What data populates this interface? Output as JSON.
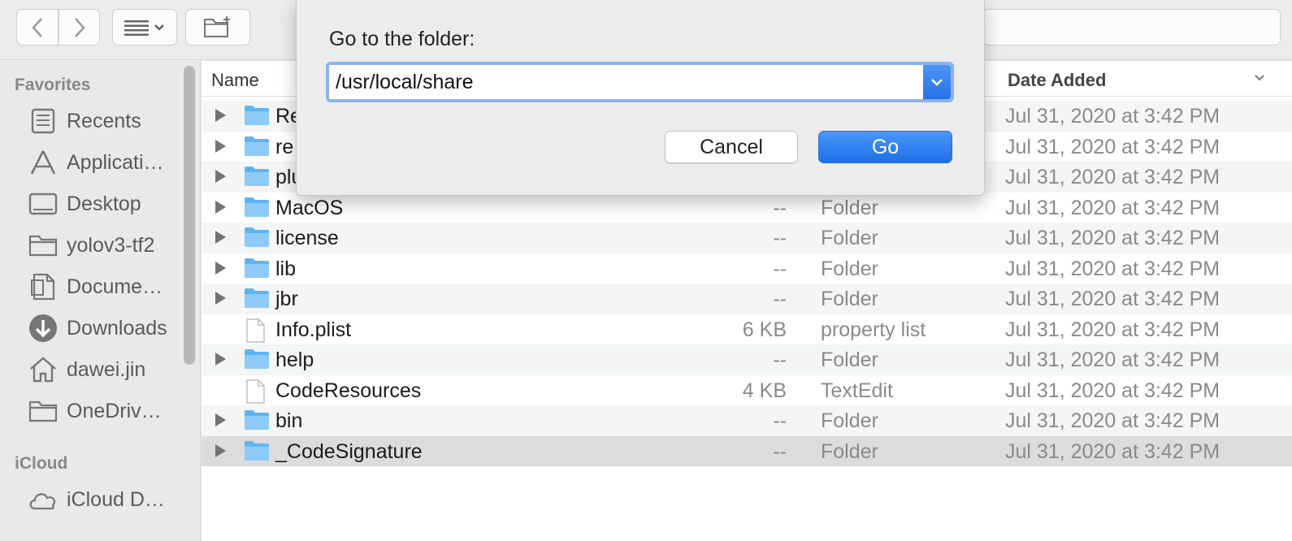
{
  "toolbar": {
    "back_icon": "chevron-left-icon",
    "forward_icon": "chevron-right-icon",
    "view_icon": "list-view-icon",
    "new_folder_icon": "new-folder-icon"
  },
  "sidebar": {
    "favorites_header": "Favorites",
    "icloud_header": "iCloud",
    "favorites": [
      {
        "label": "Recents",
        "icon": "recents-icon"
      },
      {
        "label": "Applicati…",
        "icon": "applications-icon"
      },
      {
        "label": "Desktop",
        "icon": "desktop-icon"
      },
      {
        "label": "yolov3-tf2",
        "icon": "folder-icon"
      },
      {
        "label": "Docume…",
        "icon": "document-icon"
      },
      {
        "label": "Downloads",
        "icon": "downloads-icon"
      },
      {
        "label": "dawei.jin",
        "icon": "home-icon"
      },
      {
        "label": "OneDriv…",
        "icon": "folder-icon"
      }
    ],
    "icloud": [
      {
        "label": "iCloud D…",
        "icon": "cloud-icon"
      }
    ]
  },
  "columns": {
    "name": "Name",
    "date_added": "Date Added"
  },
  "files": [
    {
      "name": "Re",
      "size": "",
      "kind": "",
      "date": "Jul 31, 2020 at 3:42 PM",
      "type": "folder"
    },
    {
      "name": "re",
      "size": "",
      "kind": "",
      "date": "Jul 31, 2020 at 3:42 PM",
      "type": "folder"
    },
    {
      "name": "plu",
      "size": "",
      "kind": "",
      "date": "Jul 31, 2020 at 3:42 PM",
      "type": "folder"
    },
    {
      "name": "MacOS",
      "size": "--",
      "kind": "Folder",
      "date": "Jul 31, 2020 at 3:42 PM",
      "type": "folder"
    },
    {
      "name": "license",
      "size": "--",
      "kind": "Folder",
      "date": "Jul 31, 2020 at 3:42 PM",
      "type": "folder"
    },
    {
      "name": "lib",
      "size": "--",
      "kind": "Folder",
      "date": "Jul 31, 2020 at 3:42 PM",
      "type": "folder"
    },
    {
      "name": "jbr",
      "size": "--",
      "kind": "Folder",
      "date": "Jul 31, 2020 at 3:42 PM",
      "type": "folder"
    },
    {
      "name": "Info.plist",
      "size": "6 KB",
      "kind": "property list",
      "date": "Jul 31, 2020 at 3:42 PM",
      "type": "file"
    },
    {
      "name": "help",
      "size": "--",
      "kind": "Folder",
      "date": "Jul 31, 2020 at 3:42 PM",
      "type": "folder"
    },
    {
      "name": "CodeResources",
      "size": "4 KB",
      "kind": "TextEdit",
      "date": "Jul 31, 2020 at 3:42 PM",
      "type": "file"
    },
    {
      "name": "bin",
      "size": "--",
      "kind": "Folder",
      "date": "Jul 31, 2020 at 3:42 PM",
      "type": "folder"
    },
    {
      "name": "_CodeSignature",
      "size": "--",
      "kind": "Folder",
      "date": "Jul 31, 2020 at 3:42 PM",
      "type": "folder",
      "selected": true
    }
  ],
  "dialog": {
    "prompt": "Go to the folder:",
    "path_value": "/usr/local/share",
    "cancel_label": "Cancel",
    "go_label": "Go"
  },
  "colors": {
    "accent": "#1d6fe6",
    "folder": "#7cc3f5",
    "focus_ring": "#8bb3ef"
  }
}
